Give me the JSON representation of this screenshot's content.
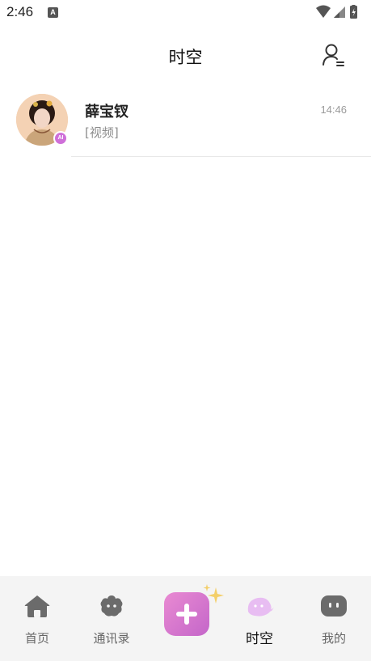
{
  "status_bar": {
    "time": "2:46",
    "notification_icon": "A",
    "icons": [
      "wifi-icon",
      "signal-icon",
      "battery-charging-icon"
    ]
  },
  "header": {
    "title": "时空",
    "right_icon": "contacts-manage-icon"
  },
  "chats": [
    {
      "name": "薛宝钗",
      "preview": "[视频]",
      "time": "14:46",
      "badge": "AI"
    }
  ],
  "tabbar": {
    "home": "首页",
    "contacts": "通讯录",
    "create_icon": "plus-icon",
    "timespace": "时空",
    "mine": "我的",
    "active_tab": "timespace"
  },
  "colors": {
    "accent_gradient_start": "#e98ad2",
    "accent_gradient_end": "#c466c9",
    "ai_badge": "#cf6fd9",
    "tab_icon_inactive": "#6b6b6b",
    "tab_icon_active": "#e3b6ef"
  }
}
